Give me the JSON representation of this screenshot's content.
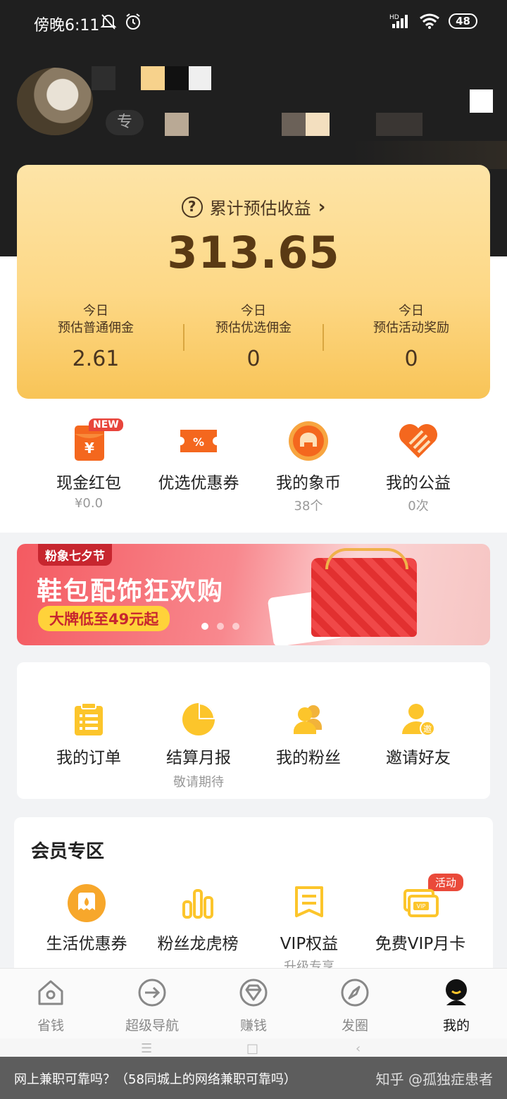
{
  "status_bar": {
    "time": "傍晚6:11",
    "network": "HD",
    "battery": "48"
  },
  "profile": {
    "badge_prefix": "专"
  },
  "earnings": {
    "title": "累计预估收益",
    "total": "313.65",
    "columns": [
      {
        "line1": "今日",
        "line2": "预估普通佣金",
        "value": "2.61"
      },
      {
        "line1": "今日",
        "line2": "预估优选佣金",
        "value": "0"
      },
      {
        "line1": "今日",
        "line2": "预估活动奖励",
        "value": "0"
      }
    ]
  },
  "quick": [
    {
      "label": "现金红包",
      "sub": "¥0.0",
      "tag": "NEW"
    },
    {
      "label": "优选优惠券",
      "sub": ""
    },
    {
      "label": "我的象币",
      "sub": "38个"
    },
    {
      "label": "我的公益",
      "sub": "0次"
    }
  ],
  "banner": {
    "tag": "粉象七夕节",
    "headline": "鞋包配饰狂欢购",
    "sub": "大牌低至49元起"
  },
  "orders": [
    {
      "label": "我的订单",
      "sub": ""
    },
    {
      "label": "结算月报",
      "sub": "敬请期待"
    },
    {
      "label": "我的粉丝",
      "sub": ""
    },
    {
      "label": "邀请好友",
      "sub": "",
      "icon_text": "邀"
    }
  ],
  "member": {
    "title": "会员专区",
    "items": [
      {
        "label": "生活优惠券",
        "sub": ""
      },
      {
        "label": "粉丝龙虎榜",
        "sub": ""
      },
      {
        "label": "VIP权益",
        "sub": "升级专享"
      },
      {
        "label": "免费VIP月卡",
        "sub": "",
        "tag": "活动",
        "icon_text": "VIP"
      }
    ]
  },
  "nav": [
    {
      "label": "省钱"
    },
    {
      "label": "超级导航"
    },
    {
      "label": "赚钱"
    },
    {
      "label": "发圈"
    },
    {
      "label": "我的"
    }
  ],
  "caption": {
    "left": "网上兼职可靠吗？（58同城上的网络兼职可靠吗）",
    "right": "知乎 @孤独症患者"
  },
  "colors": {
    "gold": "#fcc52b",
    "orange": "#f4671e",
    "header": "#1f1f1f",
    "brown_text": "#5a3a14"
  }
}
